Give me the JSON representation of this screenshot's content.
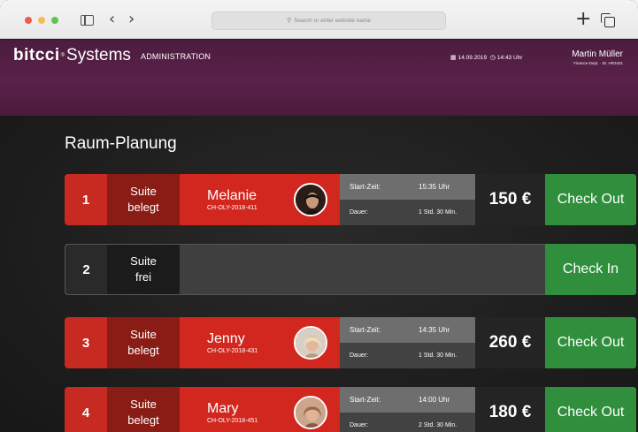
{
  "browser": {
    "address_placeholder": "Search or enter website name"
  },
  "header": {
    "brand_a": "bitcci",
    "brand_reg": "®",
    "brand_b": "Systems",
    "section": "ADMINISTRATION",
    "date": "14.09.2019",
    "time": "14:43 Uhr",
    "user_name": "Martin Müller",
    "user_meta": "Finance-Dept. · ID: HR3401"
  },
  "page": {
    "title": "Raum-Planung"
  },
  "labels": {
    "start": "Start-Zeit:",
    "duration": "Dauer:"
  },
  "rooms": [
    {
      "number": "1",
      "status_line1": "Suite",
      "status_line2": "belegt",
      "guest_name": "Melanie",
      "guest_id": "CH-OLY-2018-411",
      "start_time": "15:35 Uhr",
      "duration": "1 Std. 30 Min.",
      "price": "150 €",
      "action": "Check Out"
    },
    {
      "number": "2",
      "status_line1": "Suite",
      "status_line2": "frei",
      "action": "Check In"
    },
    {
      "number": "3",
      "status_line1": "Suite",
      "status_line2": "belegt",
      "guest_name": "Jenny",
      "guest_id": "CH-OLY-2018-431",
      "start_time": "14:35 Uhr",
      "duration": "1 Std. 30 Min.",
      "price": "260 €",
      "action": "Check Out"
    },
    {
      "number": "4",
      "status_line1": "Suite",
      "status_line2": "belegt",
      "guest_name": "Mary",
      "guest_id": "CH-OLY-2018-451",
      "start_time": "14:00 Uhr",
      "duration": "2 Std. 30 Min.",
      "price": "180 €",
      "action": "Check Out"
    }
  ],
  "icons": {
    "sidebar": "sidebar-icon",
    "back": "chevron-left-icon",
    "forward": "chevron-right-icon",
    "search": "search-icon",
    "new_tab": "plus-icon",
    "tabs": "tabs-icon",
    "calendar": "calendar-icon",
    "clock": "clock-icon"
  },
  "colors": {
    "header_bg": "#5a2249",
    "occupied_red": "#d1271f",
    "occupied_dark_red": "#8a1c16",
    "action_green": "#2f8f3d",
    "free_gray": "#3f3f3f"
  }
}
